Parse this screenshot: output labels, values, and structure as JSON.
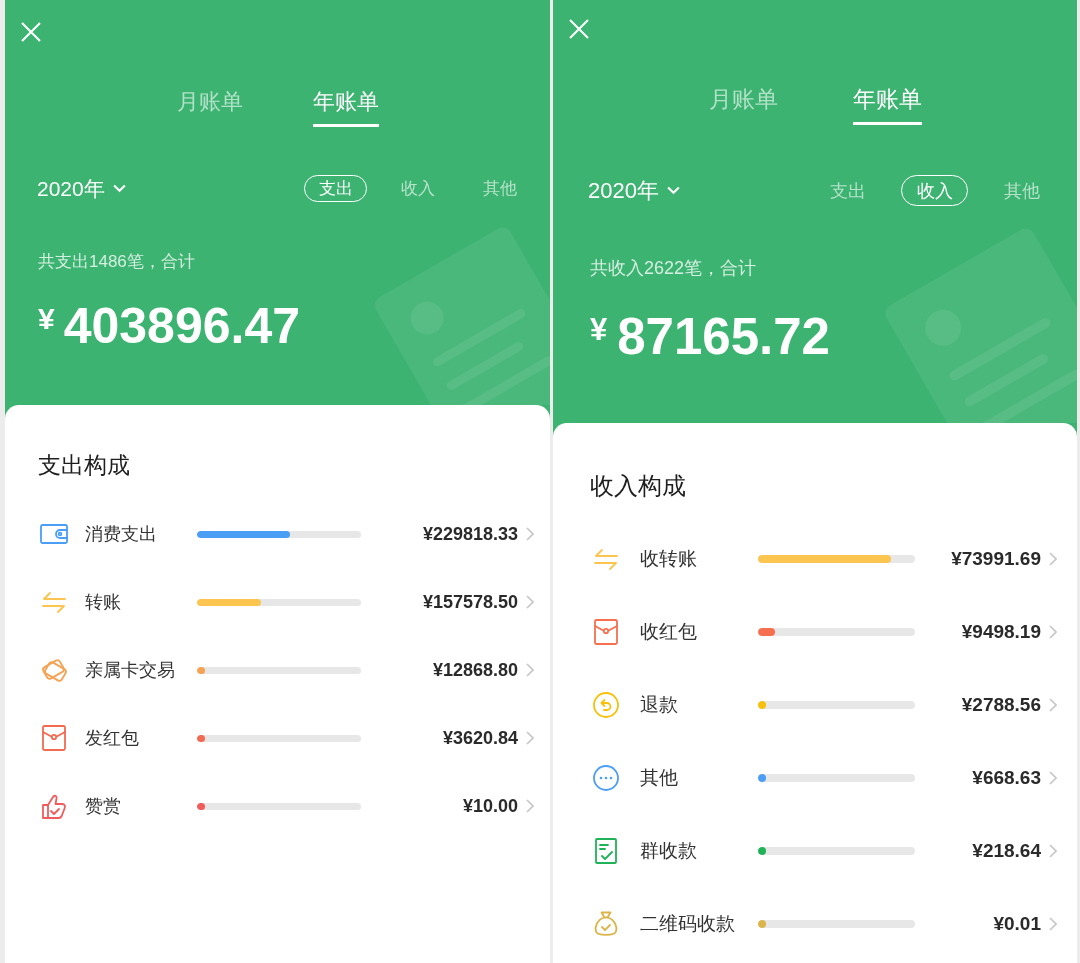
{
  "screens": [
    {
      "tabs": [
        {
          "label": "月账单",
          "selected": false
        },
        {
          "label": "年账单",
          "selected": true
        }
      ],
      "year": "2020年",
      "filters": [
        {
          "label": "支出",
          "selected": true
        },
        {
          "label": "收入",
          "selected": false
        },
        {
          "label": "其他",
          "selected": false
        }
      ],
      "summary": {
        "caption": "共支出1486笔，合计",
        "currency": "¥",
        "total": "403896.47"
      },
      "breakdown": {
        "title": "支出构成",
        "items": [
          {
            "kind": "wallet",
            "label": "消费支出",
            "level": 0.57,
            "amount": "¥229818.33",
            "color": "#4a9ef5"
          },
          {
            "kind": "transfer",
            "label": "转账",
            "level": 0.39,
            "amount": "¥157578.50",
            "color": "#fbc54f"
          },
          {
            "kind": "family-card",
            "label": "亲属卡交易",
            "level": 0.05,
            "amount": "¥12868.80",
            "color": "#f5a253"
          },
          {
            "kind": "red-packet",
            "label": "发红包",
            "level": 0.05,
            "amount": "¥3620.84",
            "color": "#f26a50"
          },
          {
            "kind": "reward",
            "label": "赞赏",
            "level": 0.05,
            "amount": "¥10.00",
            "color": "#f25b5b"
          }
        ]
      }
    },
    {
      "tabs": [
        {
          "label": "月账单",
          "selected": false
        },
        {
          "label": "年账单",
          "selected": true
        }
      ],
      "year": "2020年",
      "filters": [
        {
          "label": "支出",
          "selected": false
        },
        {
          "label": "收入",
          "selected": true
        },
        {
          "label": "其他",
          "selected": false
        }
      ],
      "summary": {
        "caption": "共收入2622笔，合计",
        "currency": "¥",
        "total": "87165.72"
      },
      "breakdown": {
        "title": "收入构成",
        "items": [
          {
            "kind": "transfer",
            "label": "收转账",
            "level": 0.85,
            "amount": "¥73991.69",
            "color": "#fbc54f"
          },
          {
            "kind": "red-packet",
            "label": "收红包",
            "level": 0.11,
            "amount": "¥9498.19",
            "color": "#f6704f"
          },
          {
            "kind": "refund",
            "label": "退款",
            "level": 0.05,
            "amount": "¥2788.56",
            "color": "#f7c10b"
          },
          {
            "kind": "more",
            "label": "其他",
            "level": 0.05,
            "amount": "¥668.63",
            "color": "#4a9ef5"
          },
          {
            "kind": "group-collect",
            "label": "群收款",
            "level": 0.05,
            "amount": "¥218.64",
            "color": "#1fb257"
          },
          {
            "kind": "qr-collect",
            "label": "二维码收款",
            "level": 0.05,
            "amount": "¥0.01",
            "color": "#dbb54a"
          }
        ]
      }
    }
  ]
}
